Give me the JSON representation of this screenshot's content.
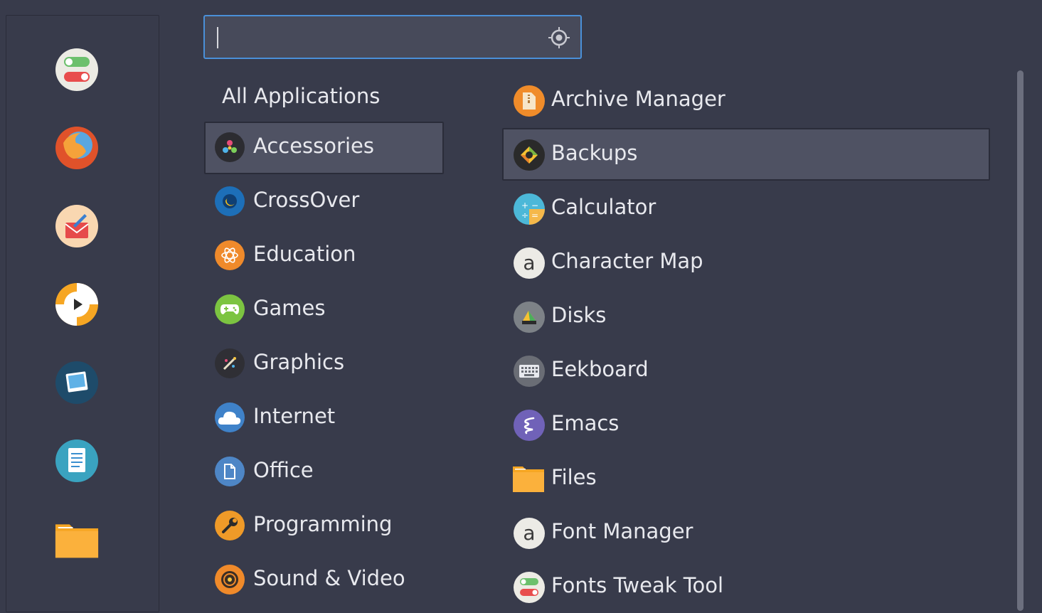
{
  "search": {
    "value": "",
    "placeholder": ""
  },
  "favorites": [
    {
      "name": "settings-toggle-icon"
    },
    {
      "name": "firefox-icon"
    },
    {
      "name": "mail-icon"
    },
    {
      "name": "media-player-icon"
    },
    {
      "name": "image-viewer-icon"
    },
    {
      "name": "text-editor-icon"
    },
    {
      "name": "folder-icon"
    }
  ],
  "categories": {
    "all_label": "All Applications",
    "items": [
      {
        "label": "Accessories",
        "icon": "accessories-icon",
        "selected": true
      },
      {
        "label": "CrossOver",
        "icon": "crossover-icon"
      },
      {
        "label": "Education",
        "icon": "education-icon"
      },
      {
        "label": "Games",
        "icon": "games-icon"
      },
      {
        "label": "Graphics",
        "icon": "graphics-icon"
      },
      {
        "label": "Internet",
        "icon": "internet-icon"
      },
      {
        "label": "Office",
        "icon": "office-icon"
      },
      {
        "label": "Programming",
        "icon": "programming-icon"
      },
      {
        "label": "Sound & Video",
        "icon": "sound-video-icon"
      }
    ]
  },
  "apps": {
    "items": [
      {
        "label": "Archive Manager",
        "icon": "archive-icon"
      },
      {
        "label": "Backups",
        "icon": "backups-icon",
        "selected": true
      },
      {
        "label": "Calculator",
        "icon": "calculator-icon"
      },
      {
        "label": "Character Map",
        "icon": "character-map-icon"
      },
      {
        "label": "Disks",
        "icon": "disks-icon"
      },
      {
        "label": "Eekboard",
        "icon": "keyboard-icon"
      },
      {
        "label": "Emacs",
        "icon": "emacs-icon"
      },
      {
        "label": "Files",
        "icon": "files-icon"
      },
      {
        "label": "Font Manager",
        "icon": "font-manager-icon"
      },
      {
        "label": "Fonts Tweak Tool",
        "icon": "fonts-tweak-icon"
      }
    ]
  },
  "colors": {
    "background": "#383b4b",
    "selection": "#4f5263",
    "accent": "#4a90d9"
  }
}
